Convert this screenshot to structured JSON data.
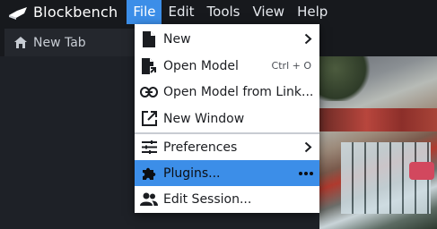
{
  "app": {
    "name": "Blockbench"
  },
  "menubar": {
    "items": [
      {
        "label": "File"
      },
      {
        "label": "Edit"
      },
      {
        "label": "Tools"
      },
      {
        "label": "View"
      },
      {
        "label": "Help"
      }
    ],
    "active_index": 0
  },
  "tabs": [
    {
      "label": "New Tab",
      "icon": "home-icon"
    }
  ],
  "file_menu": {
    "items": [
      {
        "label": "New",
        "icon": "file-icon",
        "submenu": true
      },
      {
        "label": "Open Model",
        "icon": "file-open-icon",
        "shortcut": "Ctrl + O"
      },
      {
        "label": "Open Model from Link...",
        "icon": "link-icon"
      },
      {
        "label": "New Window",
        "icon": "open-in-new-icon"
      },
      {
        "label": "Preferences",
        "icon": "sliders-icon",
        "submenu": true
      },
      {
        "label": "Plugins...",
        "icon": "puzzle-icon",
        "more": true,
        "highlighted": true
      },
      {
        "label": "Edit Session...",
        "icon": "people-icon"
      }
    ]
  },
  "colors": {
    "accent": "#3c8ee8",
    "menubar_bg": "#17191d",
    "workspace_bg": "#1e2127",
    "menu_bg": "#ffffff"
  }
}
